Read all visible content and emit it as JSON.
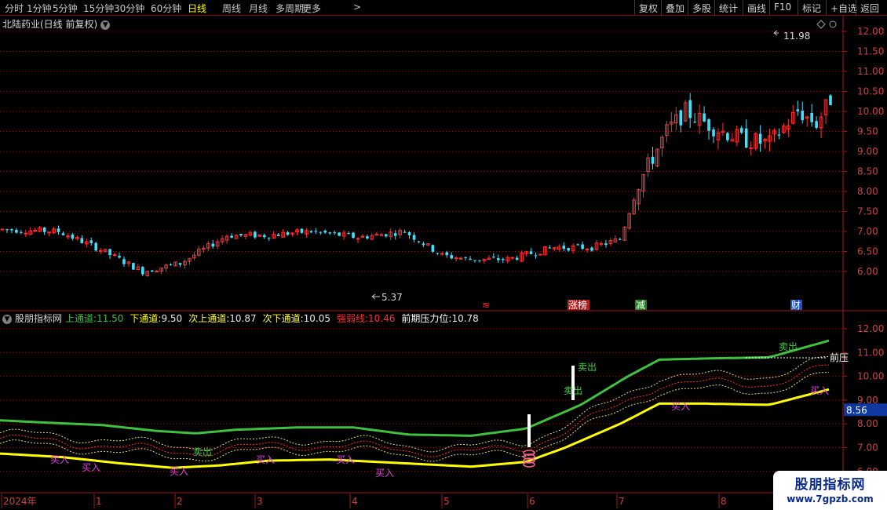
{
  "toolbar": {
    "periods": [
      "分时",
      "1分钟",
      "5分钟",
      "15分钟",
      "30分钟",
      "60分钟",
      "日线",
      "周线",
      "月线",
      "多周期",
      "更多"
    ],
    "active_period": "日线",
    "more_chevron": ">",
    "right_buttons": [
      "复权",
      "叠加",
      "多股",
      "统计",
      "画线",
      "F10",
      "标记",
      "+自选",
      "返回"
    ]
  },
  "main_chart": {
    "title": "北陆药业(日线 前复权)",
    "y_ticks": [
      "12.00",
      "11.50",
      "11.00",
      "10.50",
      "10.00",
      "9.50",
      "9.00",
      "8.50",
      "8.00",
      "7.50",
      "7.00",
      "6.50",
      "6.00"
    ],
    "high_label": "11.98",
    "low_label": "5.37",
    "markers": [
      {
        "text": "≋",
        "color": "#ff3030"
      },
      {
        "text": "涨榜",
        "color": "#ffffff",
        "bg": "#b02020"
      },
      {
        "text": "减",
        "color": "#ffffff",
        "bg": "#208020"
      },
      {
        "text": "财",
        "color": "#ffffff",
        "bg": "#2050c0"
      }
    ],
    "up_color": "#ff3030",
    "down_color": "#40e0ff"
  },
  "indicator": {
    "name": "股朋指标网",
    "values": [
      {
        "label": "上通道:",
        "value": "11.50",
        "color": "#40c040"
      },
      {
        "label": "下通道:",
        "value": "9.50",
        "color": "#ffff00"
      },
      {
        "label": "次上通道:",
        "value": "10.87",
        "color": "#ffff40"
      },
      {
        "label": "次下通道:",
        "value": "10.05",
        "color": "#ffff40"
      },
      {
        "label": "强弱线:",
        "value": "10.46",
        "color": "#ff3030"
      },
      {
        "label": "前期压力位:",
        "value": "10.78",
        "color": "#ffffff"
      }
    ],
    "y_ticks": [
      "12.00",
      "11.00",
      "10.00",
      "9.00",
      "8.00",
      "7.00",
      "6.00"
    ],
    "current_value": "8.56",
    "pressure_label": "前压",
    "sell_label": "卖出",
    "buy_label": "买入",
    "upper_color": "#40c040",
    "lower_color": "#ffff00"
  },
  "x_axis": {
    "labels": [
      "2024年",
      "1",
      "2",
      "3",
      "4",
      "5",
      "6",
      "7",
      "8"
    ]
  },
  "watermark": {
    "title": "股朋指标网",
    "url": "www.7gpzb.com"
  }
}
